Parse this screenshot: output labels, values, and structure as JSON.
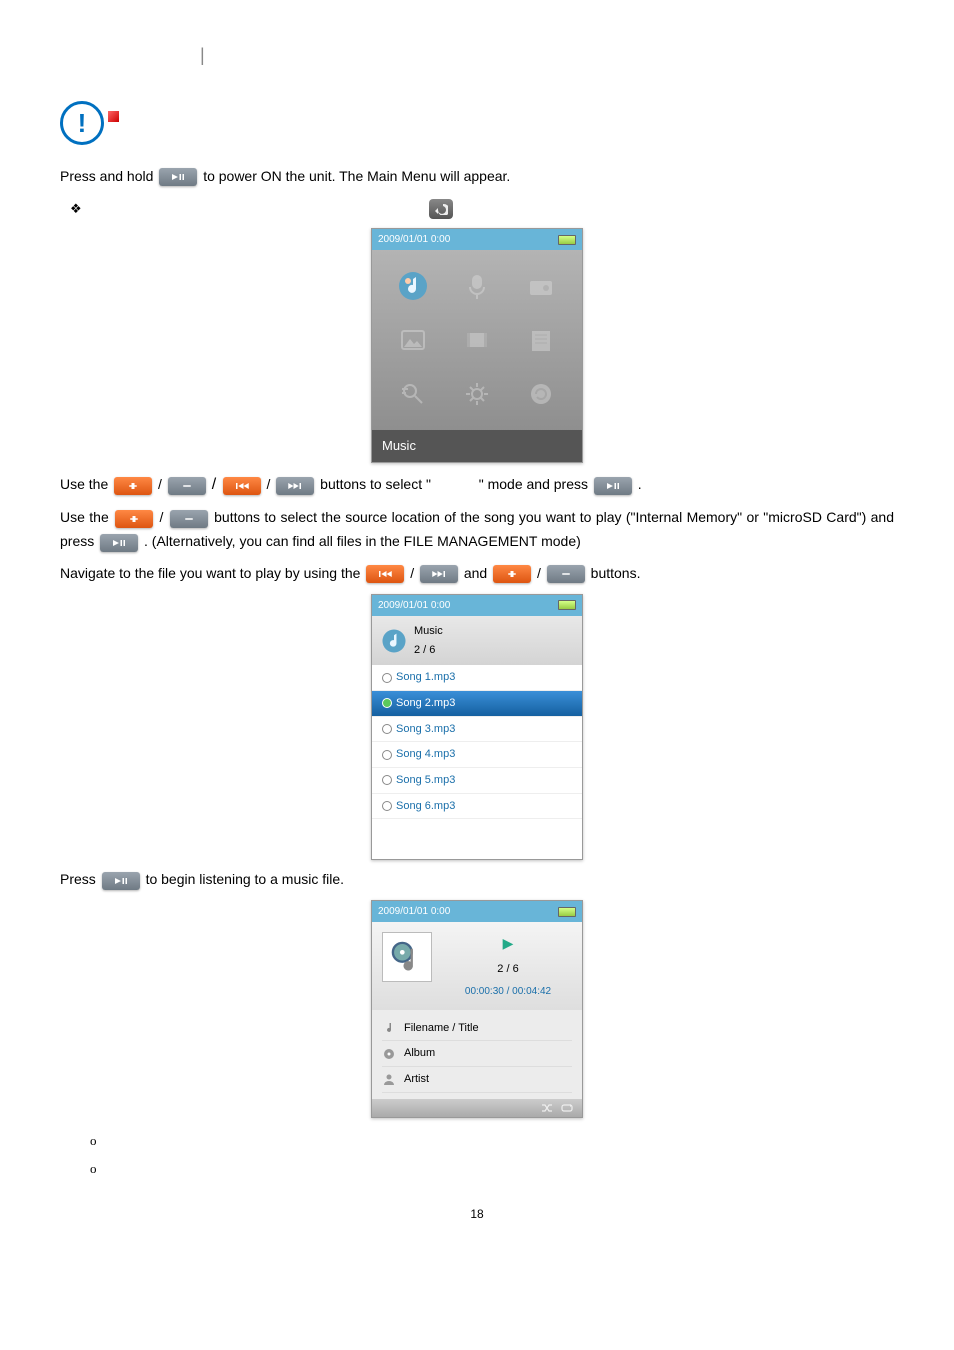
{
  "alert_glyph": "!",
  "status_bar": {
    "datetime": "2009/01/01  0:00"
  },
  "main_menu_label": "Music",
  "intro": {
    "p1a": "Press and hold ",
    "p1b": " to power ON the unit. The Main Menu will appear."
  },
  "nav": {
    "use_the": "Use the ",
    "slash": " / ",
    "buttons_select": " buttons to select \"",
    "mode_and_press": "\" mode and press ",
    "dot": "."
  },
  "source": {
    "a": "Use the ",
    "b": " buttons to select the source location of the song you want to play  (\"Internal Memory\" or \"microSD Card\") and press ",
    "c": ". (Alternatively, you can find all files in the FILE MANAGEMENT mode)"
  },
  "navigate": {
    "a": "Navigate to the file you want to play by using the ",
    "b": " and ",
    "c": " buttons."
  },
  "press_begin": {
    "a": "Press ",
    "b": " to begin listening to a music file."
  },
  "list_header": {
    "title": "Music",
    "counter": "2 / 6"
  },
  "files": [
    {
      "name": "Song 1.mp3",
      "selected": false
    },
    {
      "name": "Song 2.mp3",
      "selected": true
    },
    {
      "name": "Song 3.mp3",
      "selected": false
    },
    {
      "name": "Song 4.mp3",
      "selected": false
    },
    {
      "name": "Song 5.mp3",
      "selected": false
    },
    {
      "name": "Song 6.mp3",
      "selected": false
    }
  ],
  "player": {
    "counter": "2 / 6",
    "time": "00:00:30 / 00:04:42",
    "title": "Filename / Title",
    "album": "Album",
    "artist": "Artist"
  },
  "bullets": {
    "b1": "o",
    "b2": "o"
  },
  "page_number": "18"
}
